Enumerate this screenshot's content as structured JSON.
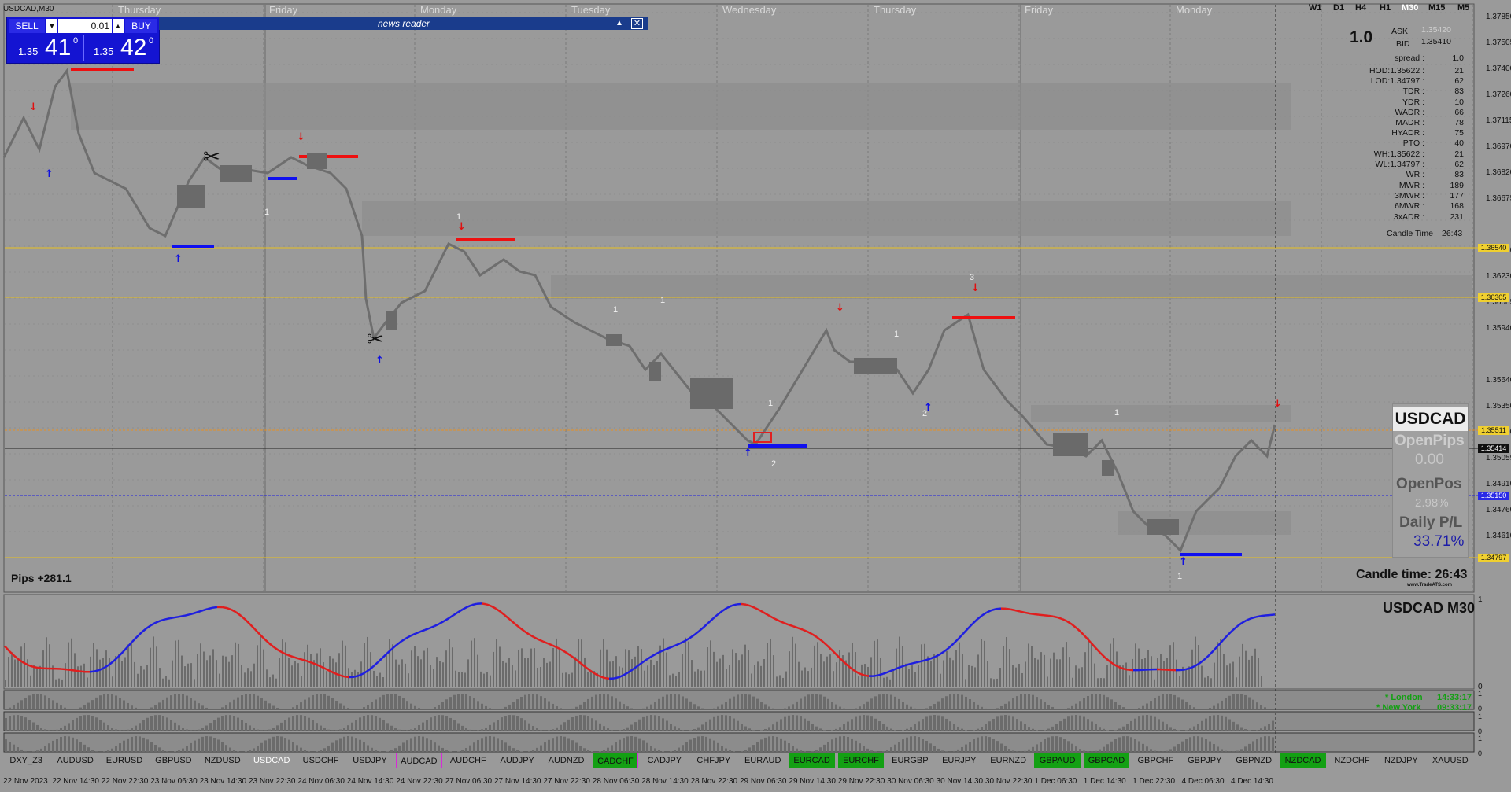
{
  "window": {
    "title": "USDCAD,M30"
  },
  "timeframes": [
    "W1",
    "D1",
    "H4",
    "H1",
    "M30",
    "M15",
    "M5"
  ],
  "active_timeframe": "M30",
  "trade_panel": {
    "sell_label": "SELL",
    "buy_label": "BUY",
    "lot_value": "0.01",
    "sell_price_small": "1.35",
    "sell_price_big": "41",
    "sell_price_sup": "0",
    "buy_price_small": "1.35",
    "buy_price_big": "42",
    "buy_price_sup": "0"
  },
  "news_reader": {
    "title": "news reader"
  },
  "day_labels": [
    "Thursday",
    "Friday",
    "Monday",
    "Tuesday",
    "Wednesday",
    "Thursday",
    "Friday",
    "Monday"
  ],
  "price_axis": [
    "1.37850",
    "1.37505",
    "1.37400",
    "1.37260",
    "1.37115",
    "1.36970",
    "1.36820",
    "1.36675",
    "1.36380",
    "1.36230",
    "1.36085",
    "1.35940",
    "1.35640",
    "1.35350",
    "1.35200",
    "1.35055",
    "1.34910",
    "1.34760",
    "1.34610"
  ],
  "price_tags": {
    "yellow_top": "1.36540",
    "yellow_mid": "1.36305",
    "orange": "1.35511",
    "black": "1.35414",
    "blue": "1.35150",
    "yellow_bottom": "1.34797"
  },
  "info_panel": {
    "spread_big": "1.0",
    "ask_label": "ASK",
    "ask_value": "1.35420",
    "bid_label": "BID",
    "bid_value": "1.35410",
    "rows": [
      {
        "k": "spread :",
        "v": "1.0"
      },
      {
        "k": "HOD:1.35622 :",
        "v": "21"
      },
      {
        "k": "LOD:1.34797 :",
        "v": "62"
      },
      {
        "k": "TDR :",
        "v": "83"
      },
      {
        "k": "YDR :",
        "v": "10"
      },
      {
        "k": "WADR :",
        "v": "66"
      },
      {
        "k": "MADR :",
        "v": "78"
      },
      {
        "k": "HYADR :",
        "v": "75"
      },
      {
        "k": "PTO :",
        "v": "40"
      },
      {
        "k": "WH:1.35622 :",
        "v": "21"
      },
      {
        "k": "WL:1.34797 :",
        "v": "62"
      },
      {
        "k": "WR :",
        "v": "83"
      },
      {
        "k": "MWR :",
        "v": "189"
      },
      {
        "k": "3MWR :",
        "v": "177"
      },
      {
        "k": "6MWR :",
        "v": "168"
      },
      {
        "k": "3xADR :",
        "v": "231"
      }
    ],
    "candle_time_label": "Candle Time",
    "candle_time_value": "26:43"
  },
  "pos_panel": {
    "symbol": "USDCAD",
    "open_pips_label": "OpenPips",
    "open_pips_value": "0.00",
    "open_pos_label": "OpenPos",
    "open_pos_value": "2.98%",
    "daily_pl_label": "Daily P/L",
    "daily_pl_value": "33.71%"
  },
  "pips_label": "Pips +281.1",
  "candle_time_big": "Candle time:  26:43",
  "brand_small": "www.TradeATS.com",
  "indicator": {
    "title": "USDCAD  M30",
    "london_label": "* London",
    "london_time": "14:33:17",
    "newyork_label": "* New York",
    "newyork_time": "09:33:17",
    "scale_top": "1",
    "scale_bottom": "0",
    "bar_scales": [
      "1",
      "0",
      "1",
      "0",
      "1",
      "0"
    ]
  },
  "symbols": [
    {
      "name": "DXY_Z3",
      "style": "normal"
    },
    {
      "name": "AUDUSD",
      "style": "normal"
    },
    {
      "name": "EURUSD",
      "style": "normal"
    },
    {
      "name": "GBPUSD",
      "style": "normal"
    },
    {
      "name": "NZDUSD",
      "style": "normal"
    },
    {
      "name": "USDCAD",
      "style": "active"
    },
    {
      "name": "USDCHF",
      "style": "normal"
    },
    {
      "name": "USDJPY",
      "style": "normal"
    },
    {
      "name": "AUDCAD",
      "style": "pink"
    },
    {
      "name": "AUDCHF",
      "style": "normal"
    },
    {
      "name": "AUDJPY",
      "style": "normal"
    },
    {
      "name": "AUDNZD",
      "style": "normal"
    },
    {
      "name": "CADCHF",
      "style": "green-pink"
    },
    {
      "name": "CADJPY",
      "style": "normal"
    },
    {
      "name": "CHFJPY",
      "style": "normal"
    },
    {
      "name": "EURAUD",
      "style": "normal"
    },
    {
      "name": "EURCAD",
      "style": "green"
    },
    {
      "name": "EURCHF",
      "style": "green"
    },
    {
      "name": "EURGBP",
      "style": "normal"
    },
    {
      "name": "EURJPY",
      "style": "normal"
    },
    {
      "name": "EURNZD",
      "style": "normal"
    },
    {
      "name": "GBPAUD",
      "style": "green"
    },
    {
      "name": "GBPCAD",
      "style": "green"
    },
    {
      "name": "GBPCHF",
      "style": "normal"
    },
    {
      "name": "GBPJPY",
      "style": "normal"
    },
    {
      "name": "GBPNZD",
      "style": "normal"
    },
    {
      "name": "NZDCAD",
      "style": "green"
    },
    {
      "name": "NZDCHF",
      "style": "normal"
    },
    {
      "name": "NZDJPY",
      "style": "normal"
    },
    {
      "name": "XAUUSD",
      "style": "normal"
    }
  ],
  "date_axis": [
    "22 Nov 2023",
    "22 Nov 14:30",
    "22 Nov 22:30",
    "23 Nov 06:30",
    "23 Nov 14:30",
    "23 Nov 22:30",
    "24 Nov 06:30",
    "24 Nov 14:30",
    "24 Nov 22:30",
    "27 Nov 06:30",
    "27 Nov 14:30",
    "27 Nov 22:30",
    "28 Nov 06:30",
    "28 Nov 14:30",
    "28 Nov 22:30",
    "29 Nov 06:30",
    "29 Nov 14:30",
    "29 Nov 22:30",
    "30 Nov 06:30",
    "30 Nov 14:30",
    "30 Nov 22:30",
    "1 Dec 06:30",
    "1 Dec 14:30",
    "1 Dec 22:30",
    "4 Dec 06:30",
    "4 Dec 14:30"
  ],
  "chart_labels": [
    "1",
    "1",
    "1",
    "1",
    "1",
    "1",
    "2",
    "3",
    "1",
    "2",
    "1"
  ]
}
